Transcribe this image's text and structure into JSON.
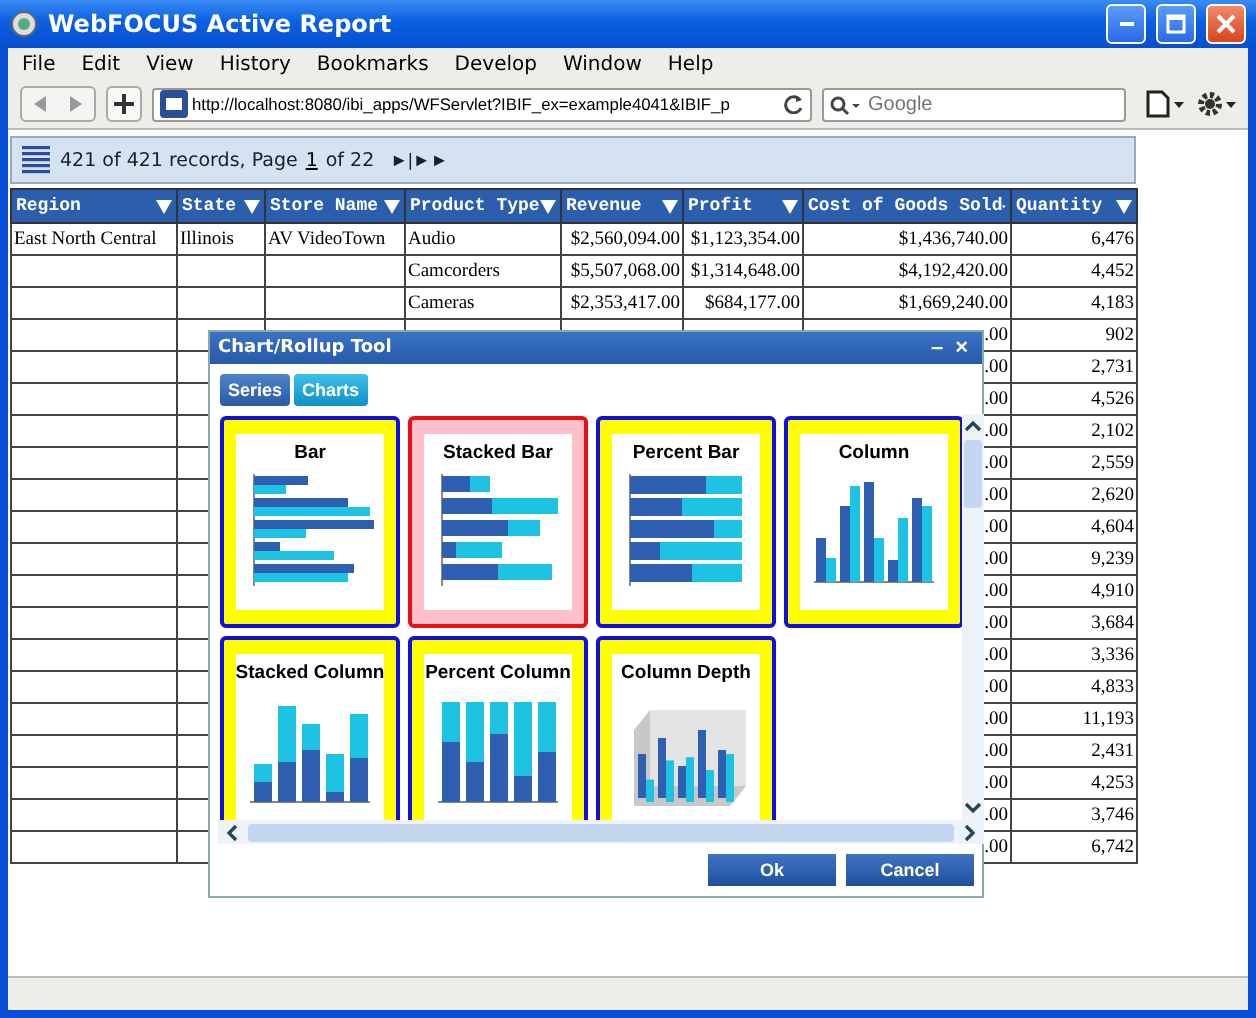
{
  "window": {
    "title": "WebFOCUS Active Report"
  },
  "menu": [
    "File",
    "Edit",
    "View",
    "History",
    "Bookmarks",
    "Develop",
    "Window",
    "Help"
  ],
  "address_bar": {
    "url": "http://localhost:8080/ibi_apps/WFServlet?IBIF_ex=example4041&IBIF_p"
  },
  "search": {
    "placeholder": "Google"
  },
  "report_toolbar": {
    "records": "421 of 421 records, Page",
    "page": "1",
    "pages": "of 22",
    "nav": "►|►►"
  },
  "table": {
    "columns": [
      "Region",
      "State",
      "Store Name",
      "Product Type",
      "Revenue",
      "Profit",
      "Cost of Goods Sold",
      "Quantity"
    ],
    "rows": [
      [
        "East North Central",
        "Illinois",
        "AV VideoTown",
        "Audio",
        "$2,560,094.00",
        "$1,123,354.00",
        "$1,436,740.00",
        "6,476"
      ],
      [
        null,
        null,
        null,
        "Camcorders",
        "$5,507,068.00",
        "$1,314,648.00",
        "$4,192,420.00",
        "4,452"
      ],
      [
        null,
        null,
        null,
        "Cameras",
        "$2,353,417.00",
        "$684,177.00",
        "$1,669,240.00",
        "4,183"
      ],
      [
        null,
        null,
        null,
        null,
        null,
        null,
        ".00",
        "902"
      ],
      [
        null,
        null,
        null,
        null,
        null,
        null,
        ".00",
        "2,731"
      ],
      [
        null,
        null,
        null,
        null,
        null,
        null,
        ".00",
        "4,526"
      ],
      [
        null,
        null,
        null,
        null,
        null,
        null,
        ".00",
        "2,102"
      ],
      [
        null,
        null,
        null,
        null,
        null,
        null,
        ".00",
        "2,559"
      ],
      [
        null,
        null,
        null,
        null,
        null,
        null,
        ".00",
        "2,620"
      ],
      [
        null,
        null,
        null,
        null,
        null,
        null,
        ".00",
        "4,604"
      ],
      [
        null,
        null,
        null,
        null,
        null,
        null,
        ".00",
        "9,239"
      ],
      [
        null,
        null,
        null,
        null,
        null,
        null,
        ".00",
        "4,910"
      ],
      [
        null,
        null,
        null,
        null,
        null,
        null,
        ".00",
        "3,684"
      ],
      [
        null,
        null,
        null,
        null,
        null,
        null,
        ".00",
        "3,336"
      ],
      [
        null,
        null,
        null,
        null,
        null,
        null,
        ".00",
        "4,833"
      ],
      [
        null,
        null,
        null,
        null,
        null,
        null,
        ".00",
        "11,193"
      ],
      [
        null,
        null,
        null,
        null,
        null,
        null,
        ".00",
        "2,431"
      ],
      [
        null,
        null,
        null,
        null,
        null,
        null,
        ".00",
        "4,253"
      ],
      [
        null,
        null,
        null,
        null,
        null,
        null,
        ".00",
        "3,746"
      ],
      [
        null,
        null,
        null,
        null,
        null,
        null,
        ".00",
        "6,742"
      ]
    ]
  },
  "dialog": {
    "title": "Chart/Rollup Tool",
    "minimize": "–",
    "close": "×",
    "tabs": [
      {
        "label": "Series",
        "selected": false
      },
      {
        "label": "Charts",
        "selected": true
      }
    ],
    "charts": [
      {
        "label": "Bar",
        "kind": "bar",
        "selected": false
      },
      {
        "label": "Stacked Bar",
        "kind": "stacked_bar",
        "selected": true
      },
      {
        "label": "Percent Bar",
        "kind": "percent_bar",
        "selected": false
      },
      {
        "label": "Column",
        "kind": "column",
        "selected": false
      },
      {
        "label": "Stacked Column",
        "kind": "stacked_column",
        "selected": false
      },
      {
        "label": "Percent Column",
        "kind": "percent_column",
        "selected": false
      },
      {
        "label": "Column Depth",
        "kind": "column_depth",
        "selected": false
      }
    ],
    "buttons": [
      "Ok",
      "Cancel"
    ]
  }
}
